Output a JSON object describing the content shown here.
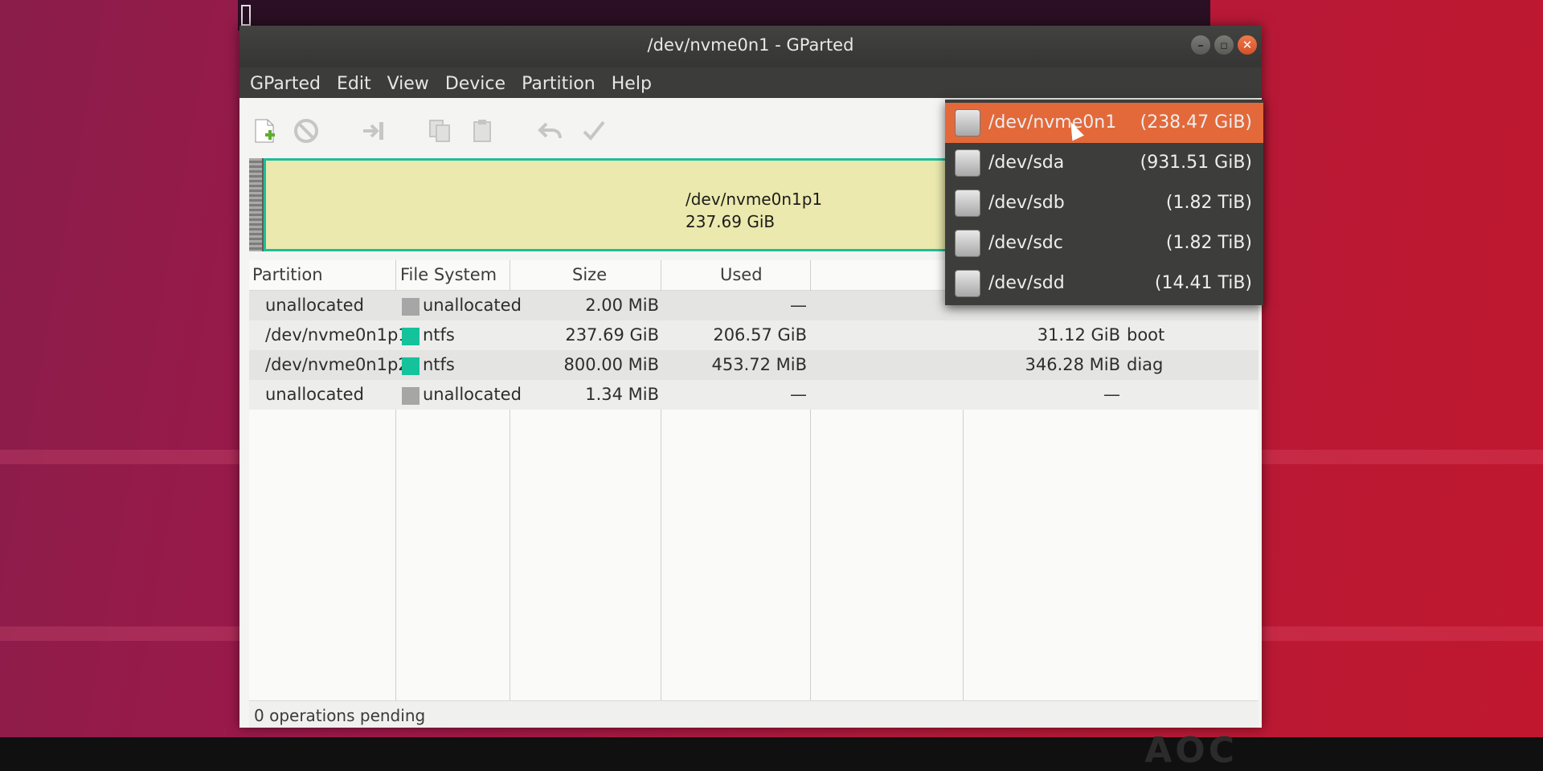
{
  "window": {
    "title": "/dev/nvme0n1 - GParted"
  },
  "menubar": {
    "items": [
      "GParted",
      "Edit",
      "View",
      "Device",
      "Partition",
      "Help"
    ]
  },
  "toolbar": {
    "icons": [
      "new-partition-icon",
      "delete-partition-icon",
      "resize-move-icon",
      "copy-icon",
      "paste-icon",
      "undo-icon",
      "apply-icon"
    ]
  },
  "disk_map": {
    "partition_name": "/dev/nvme0n1p1",
    "partition_size": "237.69 GiB",
    "fill_color": "#ebe9ad",
    "border_color": "#1fbd98"
  },
  "table": {
    "headers": [
      "Partition",
      "File System",
      "Size",
      "Used"
    ],
    "rows": [
      {
        "partition": "unallocated",
        "filesystem": "unallocated",
        "fs_color": "#a6a6a6",
        "size": "2.00 MiB",
        "used": "—",
        "unused": "",
        "flags": ""
      },
      {
        "partition": "/dev/nvme0n1p1",
        "filesystem": "ntfs",
        "fs_color": "#14c29b",
        "size": "237.69 GiB",
        "used": "206.57 GiB",
        "unused": "31.12 GiB",
        "flags": "boot"
      },
      {
        "partition": "/dev/nvme0n1p2",
        "filesystem": "ntfs",
        "fs_color": "#14c29b",
        "size": "800.00 MiB",
        "used": "453.72 MiB",
        "unused": "346.28 MiB",
        "flags": "diag"
      },
      {
        "partition": "unallocated",
        "filesystem": "unallocated",
        "fs_color": "#a6a6a6",
        "size": "1.34 MiB",
        "used": "—",
        "unused": "—",
        "flags": ""
      }
    ]
  },
  "statusbar": {
    "text": "0 operations pending"
  },
  "device_dropdown": {
    "items": [
      {
        "name": "/dev/nvme0n1",
        "size": "(238.47 GiB)",
        "selected": true
      },
      {
        "name": "/dev/sda",
        "size": "(931.51 GiB)",
        "selected": false
      },
      {
        "name": "/dev/sdb",
        "size": "(1.82 TiB)",
        "selected": false
      },
      {
        "name": "/dev/sdc",
        "size": "(1.82 TiB)",
        "selected": false
      },
      {
        "name": "/dev/sdd",
        "size": "(14.41 TiB)",
        "selected": false
      }
    ],
    "selected_color": "#e3693a"
  },
  "monitor": {
    "logo": "AOC"
  }
}
